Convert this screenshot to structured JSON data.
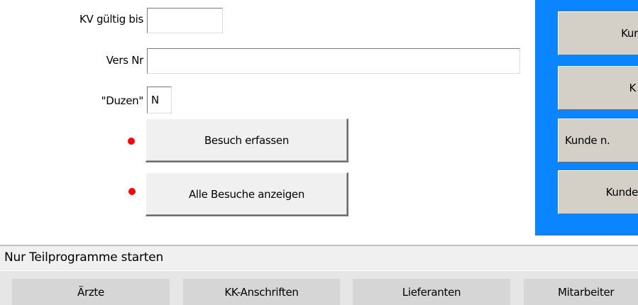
{
  "form": {
    "kv_label": "KV gültig bis",
    "kv_value": "",
    "vers_label": "Vers Nr",
    "vers_value": "",
    "duzen_label": "\"Duzen\"",
    "duzen_value": "N"
  },
  "actions": {
    "besuch_erfassen": "Besuch erfassen",
    "alle_besuche": "Alle Besuche anzeigen"
  },
  "side_panel": {
    "btn1": "Kur",
    "btn2": "K",
    "btn3": "Kunde n.",
    "btn4": "Kunde"
  },
  "status": {
    "text": "Nur Teilprogramme starten"
  },
  "bottom": {
    "aerzte": "Ärzte",
    "kk_anschriften": "KK-Anschriften",
    "lieferanten": "Lieferanten",
    "mitarbeiter": "Mitarbeiter"
  },
  "colors": {
    "panel_blue": "#0a84ff",
    "marker_red": "#ff0000"
  }
}
